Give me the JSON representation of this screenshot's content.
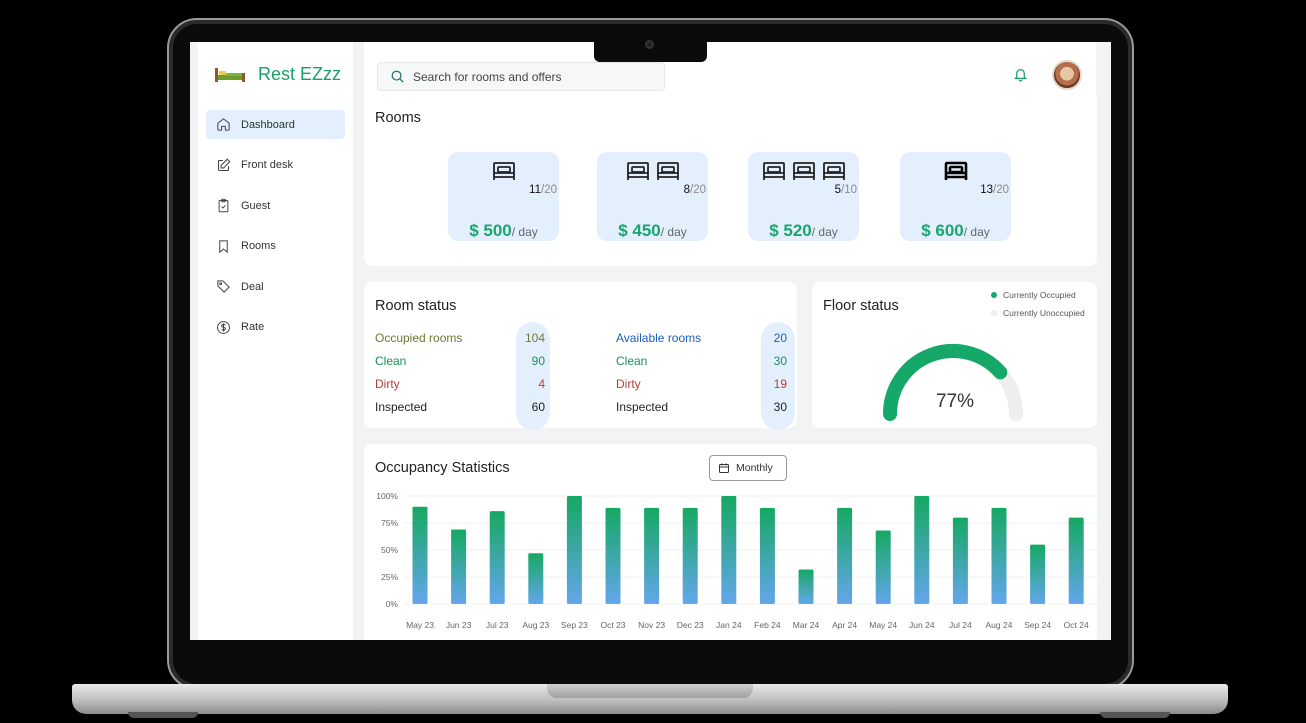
{
  "brand": {
    "name": "Rest EZzz"
  },
  "sidebar": {
    "items": [
      {
        "label": "Dashboard",
        "icon": "home-icon",
        "active": true
      },
      {
        "label": "Front desk",
        "icon": "edit-icon",
        "active": false
      },
      {
        "label": "Guest",
        "icon": "clipboard-icon",
        "active": false
      },
      {
        "label": "Rooms",
        "icon": "bookmark-icon",
        "active": false
      },
      {
        "label": "Deal",
        "icon": "tag-icon",
        "active": false
      },
      {
        "label": "Rate",
        "icon": "dollar-circle-icon",
        "active": false
      }
    ]
  },
  "search": {
    "placeholder": "Search for rooms and offers"
  },
  "rooms": {
    "title": "Rooms",
    "cards": [
      {
        "beds": 1,
        "available": "11",
        "total": "/20",
        "price": "$ 500",
        "unit": "/ day"
      },
      {
        "beds": 2,
        "available": "8",
        "total": "/20",
        "price": "$ 450",
        "unit": "/ day"
      },
      {
        "beds": 3,
        "available": "5",
        "total": "/10",
        "price": "$ 520",
        "unit": "/ day"
      },
      {
        "beds": 1,
        "available": "13",
        "total": "/20",
        "price": "$ 600",
        "unit": "/ day"
      }
    ]
  },
  "room_status": {
    "title": "Room status",
    "left": [
      {
        "label": "Occupied rooms",
        "value": "104"
      },
      {
        "label": "Clean",
        "value": "90"
      },
      {
        "label": "Dirty",
        "value": "4"
      },
      {
        "label": "Inspected",
        "value": "60"
      }
    ],
    "right": [
      {
        "label": "Available rooms",
        "value": "20"
      },
      {
        "label": "Clean",
        "value": "30"
      },
      {
        "label": "Dirty",
        "value": "19"
      },
      {
        "label": "Inspected",
        "value": "30"
      }
    ]
  },
  "floor_status": {
    "title": "Floor status",
    "legend_occupied": "Currently Occupied",
    "legend_unoccupied": "Currently Unoccupied",
    "value_label": "77%",
    "fraction": 0.77,
    "color_occupied": "#15a868",
    "color_unoccupied": "#eeeeee"
  },
  "occupancy": {
    "title": "Occupancy Statistics",
    "period": "Monthly"
  },
  "colors": {
    "accent": "#1aa66f",
    "bar_top": "#16a862",
    "bar_bottom": "#64a6ec",
    "active_bg": "#e4effd"
  },
  "chart_data": {
    "type": "bar",
    "categories": [
      "May 23",
      "Jun 23",
      "Jul 23",
      "Aug 23",
      "Sep 23",
      "Oct 23",
      "Nov 23",
      "Dec 23",
      "Jan 24",
      "Feb 24",
      "Mar 24",
      "Apr 24",
      "May 24",
      "Jun 24",
      "Jul 24",
      "Aug 24",
      "Sep 24",
      "Oct 24"
    ],
    "values": [
      90,
      69,
      86,
      47,
      100,
      89,
      89,
      89,
      100,
      89,
      32,
      89,
      68,
      100,
      80,
      89,
      55,
      80
    ],
    "ytick_labels": [
      "100%",
      "75%",
      "50%",
      "25%",
      "0%"
    ],
    "ylim": [
      0,
      100
    ],
    "grid": true
  }
}
